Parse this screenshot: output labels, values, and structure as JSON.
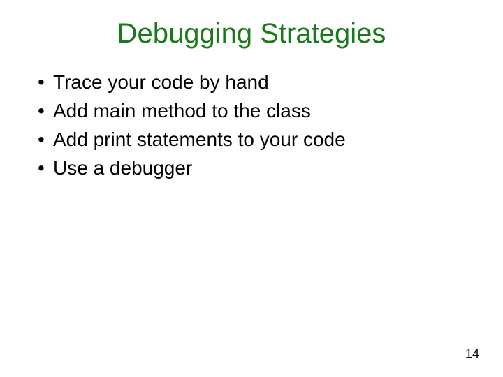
{
  "title": "Debugging Strategies",
  "bullets": [
    "Trace your code by hand",
    "Add main method to the class",
    "Add print statements to your code",
    "Use a debugger"
  ],
  "page_number": "14"
}
